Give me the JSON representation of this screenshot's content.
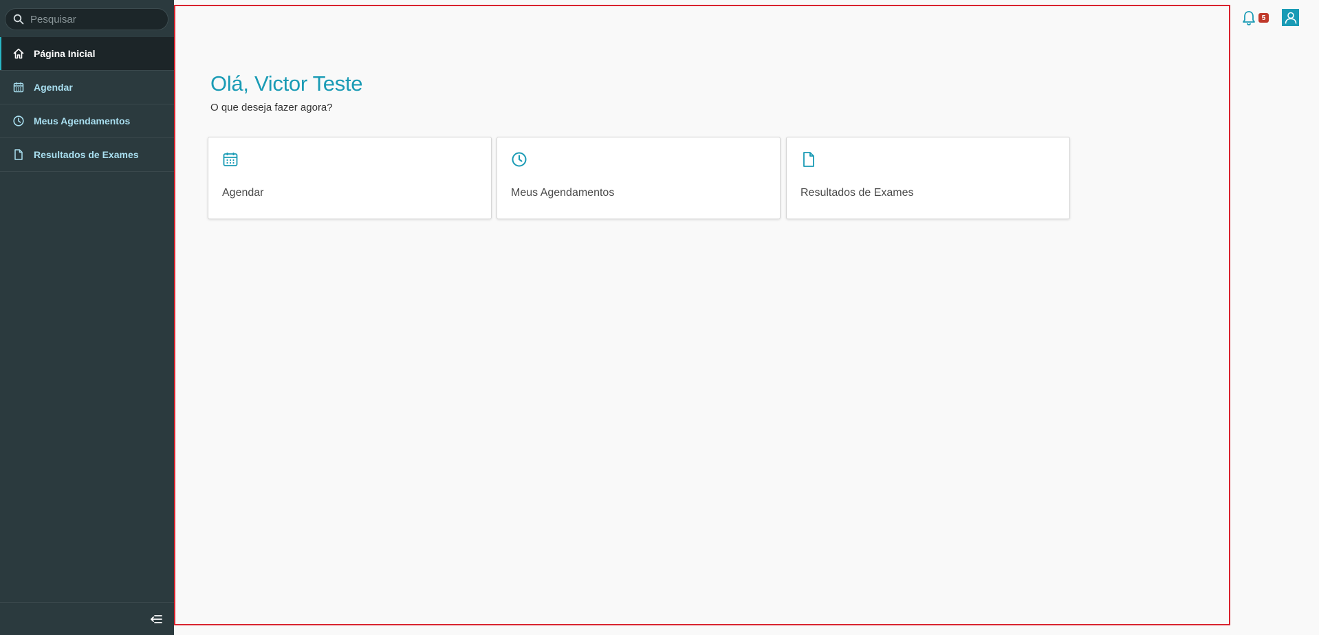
{
  "search": {
    "placeholder": "Pesquisar"
  },
  "sidebar": {
    "items": [
      {
        "label": "Página Inicial",
        "icon": "home-icon",
        "active": true
      },
      {
        "label": "Agendar",
        "icon": "calendar-icon",
        "active": false
      },
      {
        "label": "Meus Agendamentos",
        "icon": "clock-icon",
        "active": false
      },
      {
        "label": "Resultados de Exames",
        "icon": "document-icon",
        "active": false
      }
    ],
    "collapse_icon": "collapse-menu-icon"
  },
  "header": {
    "notification_count": "5",
    "bell_icon": "bell-icon",
    "profile_icon": "user-icon"
  },
  "main": {
    "greeting": "Olá, Victor Teste",
    "subtitle": "O que deseja fazer agora?",
    "cards": [
      {
        "label": "Agendar",
        "icon": "calendar-icon"
      },
      {
        "label": "Meus Agendamentos",
        "icon": "clock-icon"
      },
      {
        "label": "Resultados de Exames",
        "icon": "document-icon"
      }
    ]
  },
  "colors": {
    "accent": "#1a9bb5",
    "sidebar_bg": "#2b3a3e",
    "highlight_border": "#d9232e",
    "badge": "#c0392b"
  }
}
